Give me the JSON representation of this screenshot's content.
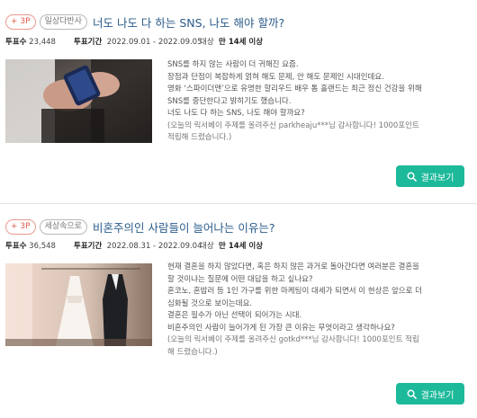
{
  "cards": [
    {
      "point_badge": "+ 3P",
      "category": "일상다반사",
      "title": "너도 나도 다 하는 SNS, 나도 해야 할까?",
      "votes_label": "투표수",
      "votes": "23,448",
      "period_label": "투표기간",
      "period": "2022.09.01 - 2022.09.05",
      "target_label": "대상",
      "target": "만 14세 이상",
      "lines": [
        "SNS를 하지 않는 사람이 더 귀해진 요즘.",
        "장점과 단점이 복잡하게 얽혀 해도 문제, 안 해도 문제인 시대인데요.",
        "영화 ‘스파이더맨’으로 유명한 할리우드 배우 톰 홀랜드는 최근 정신 건강을 위해",
        "SNS를 중단한다고 밝히기도 했습니다.",
        "너도 나도 다 하는 SNS, 나도 해야 할까요?"
      ],
      "note_lines": [
        "(오늘의 릭서베이 주제를 올려주신 parkheaju***님 감사합니다! 1000포인트",
        "적립해 드렸습니다.)"
      ],
      "button": "결과보기"
    },
    {
      "point_badge": "+ 3P",
      "category": "세상속으로",
      "title": "비혼주의인 사람들이 늘어나는 이유는?",
      "votes_label": "투표수",
      "votes": "36,548",
      "period_label": "투표기간",
      "period": "2022.08.31 - 2022.09.04",
      "target_label": "대상",
      "target": "만 14세 이상",
      "lines": [
        "현재 결혼을 하지 않았다면, 혹은 하지 않은 과거로 돌아간다면 여러분은 결혼을",
        "할 것이냐는 질문에 어떤 대답을 하고 싶나요?",
        "혼코노, 혼밥러 등 1인 가구를 위한 마케팅이 대세가 되면서 이 현상은 앞으로 더",
        "심화될 것으로 보이는데요.",
        "결혼은 필수가 아닌 선택이 되어가는 시대.",
        "비혼주의인 사람이 늘어가게 된 가장 큰 이유는 무엇이라고 생각하나요?"
      ],
      "note_lines": [
        "(오늘의 릭서베이 주제를 올려주신 gotkd***님 감사합니다! 1000포인트 적립",
        "해 드렸습니다.)"
      ],
      "button": "결과보기"
    }
  ],
  "colors": {
    "accent": "#1cb99a",
    "title": "#2a5b8a",
    "point": "#e05a4c"
  },
  "icons": {
    "button_icon": "search-icon"
  }
}
